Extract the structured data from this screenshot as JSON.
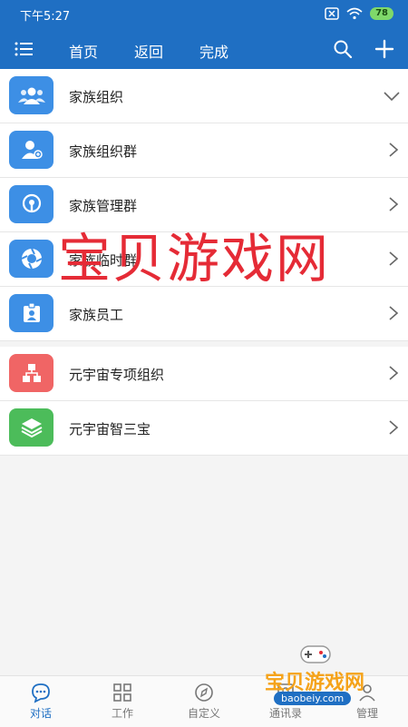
{
  "status": {
    "time": "下午5:27",
    "battery": "78"
  },
  "nav": {
    "home": "首页",
    "back": "返回",
    "done": "完成"
  },
  "section1": [
    {
      "label": "家族组织",
      "icon": "group-icon",
      "color": "#3d8fe5",
      "chevron": "down"
    },
    {
      "label": "家族组织群",
      "icon": "user-plus-icon",
      "color": "#3d8fe5",
      "chevron": "right"
    },
    {
      "label": "家族管理群",
      "icon": "lightbulb-icon",
      "color": "#3d8fe5",
      "chevron": "right"
    },
    {
      "label": "家族临时群",
      "icon": "aperture-icon",
      "color": "#3d8fe5",
      "chevron": "right"
    },
    {
      "label": "家族员工",
      "icon": "badge-icon",
      "color": "#3d8fe5",
      "chevron": "right"
    }
  ],
  "section2": [
    {
      "label": "元宇宙专项组织",
      "icon": "org-chart-icon",
      "color": "#f06565",
      "chevron": "right"
    },
    {
      "label": "元宇宙智三宝",
      "icon": "layers-icon",
      "color": "#4cbc5a",
      "chevron": "right"
    }
  ],
  "watermark": "宝贝游戏网",
  "tabs": [
    {
      "label": "对话",
      "active": true
    },
    {
      "label": "工作",
      "active": false
    },
    {
      "label": "自定义",
      "active": false
    },
    {
      "label": "通讯录",
      "active": false
    },
    {
      "label": "管理",
      "active": false
    }
  ],
  "badge": {
    "title": "宝贝游戏网",
    "url": "baobeiy.com"
  },
  "colors": {
    "primary": "#1f6fc3",
    "watermark": "#e52b36"
  }
}
